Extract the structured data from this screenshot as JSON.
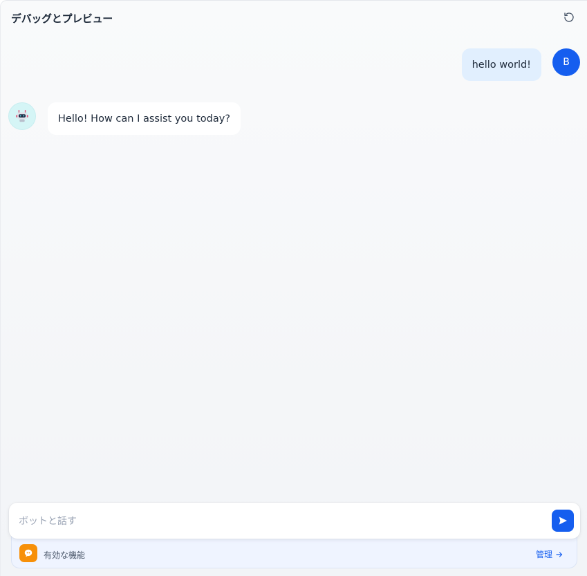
{
  "header": {
    "title": "デバッグとプレビュー",
    "refresh_icon": "refresh-icon"
  },
  "messages": [
    {
      "role": "user",
      "text": "hello world!",
      "avatar_letter": "B"
    },
    {
      "role": "bot",
      "text": "Hello! How can I assist you today?",
      "avatar_icon": "robot-icon"
    }
  ],
  "composer": {
    "placeholder": "ボットと話す",
    "value": "",
    "send_icon": "send-icon"
  },
  "features": {
    "label": "有効な機能",
    "icon": "quote-icon",
    "manage_label": "管理",
    "manage_icon": "arrow-right-icon"
  },
  "colors": {
    "accent": "#155eef",
    "user_bubble": "#e1effe",
    "feature_icon_bg": "#f79009",
    "bot_avatar_bg": "#d5f5f6"
  }
}
